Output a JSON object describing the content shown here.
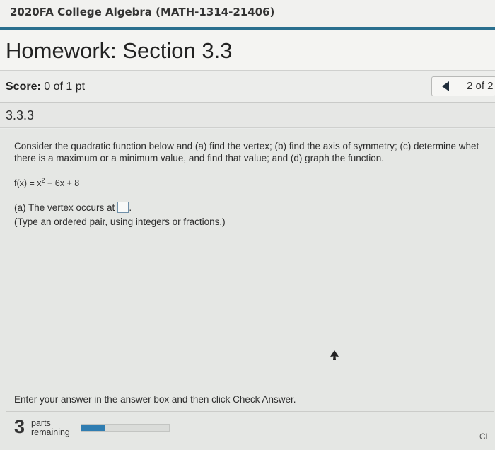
{
  "course": {
    "title": "2020FA College Algebra (MATH-1314-21406)"
  },
  "homework": {
    "title": "Homework: Section 3.3"
  },
  "score": {
    "label": "Score:",
    "value": "0 of 1 pt"
  },
  "navigation": {
    "position": "2 of 2"
  },
  "question": {
    "number": "3.3.3",
    "prompt_line1": "Consider the quadratic function below and (a) find the vertex; (b) find the axis of symmetry; (c) determine whet",
    "prompt_line2": "there is a maximum or a minimum value, and find that value; and (d) graph the function.",
    "function_prefix": "f(x) = x",
    "function_exponent": "2",
    "function_suffix": " − 6x + 8",
    "part_a_label": "(a) The vertex occurs at",
    "answer_value": "",
    "part_a_hint": "(Type an ordered pair, using integers or fractions.)"
  },
  "footer": {
    "instructions": "Enter your answer in the answer box and then click Check Answer.",
    "parts_count": "3",
    "parts_label_line1": "parts",
    "parts_label_line2": "remaining",
    "progress_fraction": 0.27,
    "clear_label": "Cl"
  },
  "colors": {
    "accent": "#2a6f8e",
    "progress": "#2f7db1"
  }
}
